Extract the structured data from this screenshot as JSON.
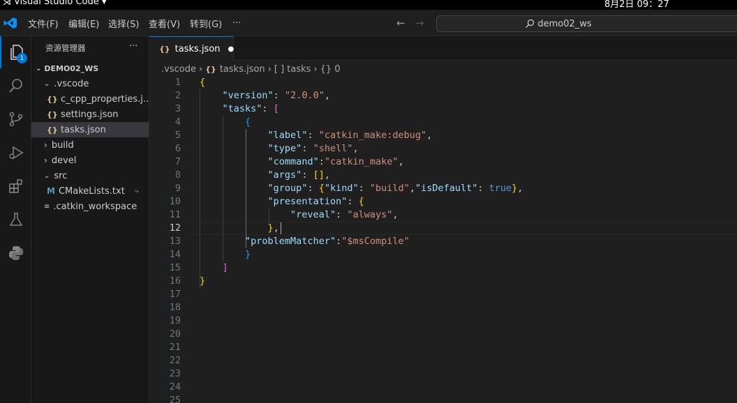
{
  "os_bar": {
    "app_name": "Visual Studio Code",
    "clock": "8月2日  09：27"
  },
  "menu": [
    "文件(F)",
    "编辑(E)",
    "选择(S)",
    "查看(V)",
    "转到(G)",
    "···"
  ],
  "command_center": {
    "label": "demo02_ws"
  },
  "activity_badge": "1",
  "explorer": {
    "title": "资源管理器",
    "more": "···",
    "root": "DEMO02_WS",
    "items": [
      {
        "label": ".vscode",
        "icon": "folder-open"
      },
      {
        "label": "c_cpp_properties.j...",
        "icon": "json"
      },
      {
        "label": "settings.json",
        "icon": "json"
      },
      {
        "label": "tasks.json",
        "icon": "json",
        "selected": true
      },
      {
        "label": "build",
        "icon": "folder"
      },
      {
        "label": "devel",
        "icon": "folder"
      },
      {
        "label": "src",
        "icon": "folder-open"
      },
      {
        "label": "CMakeLists.txt",
        "icon": "cmake"
      },
      {
        "label": ".catkin_workspace",
        "icon": "file"
      }
    ]
  },
  "tab": {
    "label": "tasks.json",
    "json_icon": "{}",
    "dirty": "●"
  },
  "breadcrumbs": [
    ".vscode",
    "tasks.json",
    "[ ] tasks",
    "{} 0"
  ],
  "line_numbers": [
    "1",
    "2",
    "3",
    "4",
    "5",
    "6",
    "7",
    "8",
    "9",
    "10",
    "11",
    "12",
    "13",
    "14",
    "15",
    "16",
    "17",
    "18",
    "19",
    "20",
    "21",
    "22",
    "23",
    "24",
    "25"
  ],
  "active_line": 12,
  "code": [
    "{",
    "    \"version\": \"2.0.0\",",
    "    \"tasks\": [",
    "        {",
    "            \"label\": \"catkin_make:debug\",",
    "            \"type\": \"shell\",",
    "            \"command\":\"catkin_make\",",
    "            \"args\": [],",
    "            \"group\": {\"kind\": \"build\",\"isDefault\": true},",
    "            \"presentation\": {",
    "                \"reveal\": \"always\",",
    "            },",
    "        \"problemMatcher\":\"$msCompile\"",
    "        }",
    "    ]",
    "}"
  ]
}
